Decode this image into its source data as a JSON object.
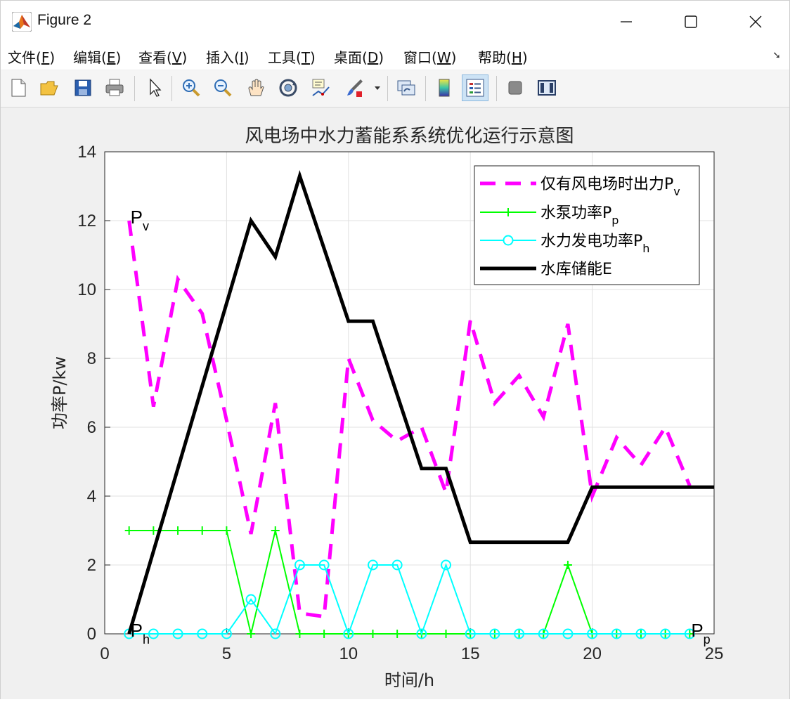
{
  "window": {
    "title": "Figure 2"
  },
  "menu": [
    {
      "label": "文件(",
      "key": "F",
      "tail": ")"
    },
    {
      "label": "编辑(",
      "key": "E",
      "tail": ")"
    },
    {
      "label": "查看(",
      "key": "V",
      "tail": ")"
    },
    {
      "label": "插入(",
      "key": "I",
      "tail": ")"
    },
    {
      "label": "工具(",
      "key": "T",
      "tail": ")"
    },
    {
      "label": "桌面(",
      "key": "D",
      "tail": ")"
    },
    {
      "label": "窗口(",
      "key": "W",
      "tail": ")"
    },
    {
      "label": "帮助(",
      "key": "H",
      "tail": ")"
    }
  ],
  "toolbar_icons": [
    "new-figure-icon",
    "open-file-icon",
    "save-icon",
    "print-icon",
    "pointer-icon",
    "zoom-in-icon",
    "zoom-out-icon",
    "pan-icon",
    "rotate-3d-icon",
    "data-cursor-icon",
    "brush-icon",
    "link-plot-icon",
    "colorbar-icon",
    "legend-icon",
    "hide-plot-tools-icon",
    "show-plot-tools-icon"
  ],
  "colors": {
    "wind": "#ff00ff",
    "pump": "#00ff00",
    "hydro": "#00ffff",
    "storage": "#000000"
  },
  "chart_data": {
    "type": "line",
    "title": "风电场中水力蓄能系系统优化运行示意图",
    "xlabel": "时间/h",
    "ylabel": "功率P/kw",
    "xlim": [
      0,
      25
    ],
    "ylim": [
      0,
      14
    ],
    "xticks": [
      0,
      5,
      10,
      15,
      20,
      25
    ],
    "yticks": [
      0,
      2,
      4,
      6,
      8,
      10,
      12,
      14
    ],
    "grid": true,
    "legend_position": "top-right",
    "series": [
      {
        "name": "仅有风电场时出力P",
        "sub": "v",
        "style": "dashed",
        "x": [
          1,
          2,
          3,
          4,
          5,
          6,
          7,
          8,
          9,
          10,
          11,
          12,
          13,
          14,
          15,
          16,
          17,
          18,
          19,
          20,
          21,
          22,
          23,
          24
        ],
        "y": [
          12,
          6.6,
          10.3,
          9.3,
          6.2,
          2.9,
          6.7,
          0.6,
          0.5,
          8,
          6.2,
          5.6,
          6.0,
          4.1,
          9.1,
          6.7,
          7.5,
          6.3,
          9.0,
          4.0,
          5.7,
          4.9,
          6.0,
          4.3
        ]
      },
      {
        "name": "水泵功率P",
        "sub": "p",
        "style": "solid",
        "marker": "plus",
        "x": [
          1,
          2,
          3,
          4,
          5,
          6,
          7,
          8,
          9,
          10,
          11,
          12,
          13,
          14,
          15,
          16,
          17,
          18,
          19,
          20,
          21,
          22,
          23,
          24
        ],
        "y": [
          3,
          3,
          3,
          3,
          3,
          0,
          3,
          0,
          0,
          0,
          0,
          0,
          0,
          0,
          0,
          0,
          0,
          0,
          2,
          0,
          0,
          0,
          0,
          0
        ]
      },
      {
        "name": "水力发电功率P",
        "sub": "h",
        "style": "solid",
        "marker": "circle",
        "x": [
          1,
          2,
          3,
          4,
          5,
          6,
          7,
          8,
          9,
          10,
          11,
          12,
          13,
          14,
          15,
          16,
          17,
          18,
          19,
          20,
          21,
          22,
          23,
          24
        ],
        "y": [
          0,
          0,
          0,
          0,
          0,
          1,
          0,
          2,
          2,
          0,
          2,
          2,
          0,
          2,
          0,
          0,
          0,
          0,
          0,
          0,
          0,
          0,
          0,
          0
        ]
      },
      {
        "name": "水库储能E",
        "sub": "",
        "style": "solid-thick",
        "x": [
          1,
          6,
          7,
          8,
          10,
          11,
          13,
          14,
          15,
          19,
          20,
          25
        ],
        "y": [
          0,
          12,
          10.95,
          13.3,
          9.08,
          9.08,
          4.8,
          4.8,
          2.66,
          2.66,
          4.26,
          4.26
        ]
      }
    ],
    "annotations": [
      {
        "text": "P",
        "sub": "v",
        "x": 1,
        "y": 12
      },
      {
        "text": "P",
        "sub": "h",
        "x": 1,
        "y": 0
      },
      {
        "text": "P",
        "sub": "p",
        "x": 24,
        "y": 0
      }
    ]
  }
}
